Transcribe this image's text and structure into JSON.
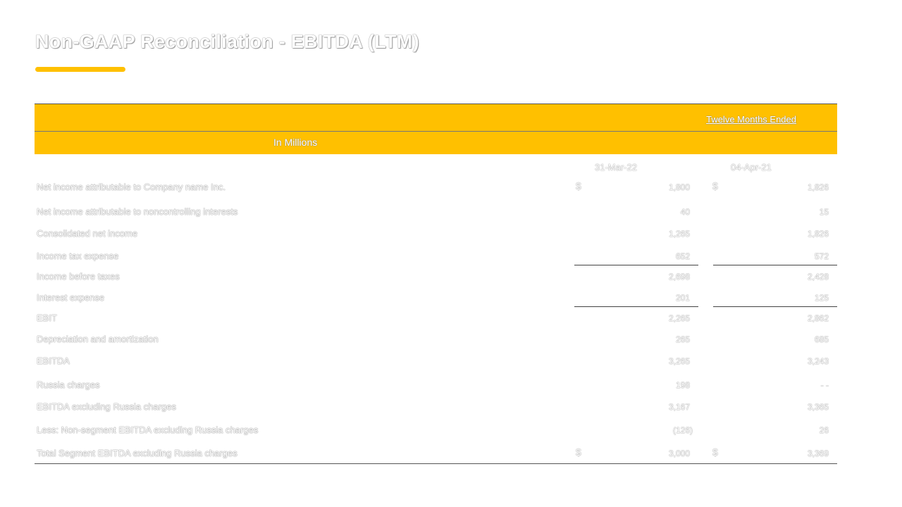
{
  "title": "Non-GAAP Reconciliation - EBITDA (LTM)",
  "table": {
    "period_header": "Twelve Months Ended",
    "units_label": "In Millions",
    "col1_date": "31-Mar-22",
    "col2_date": "04-Apr-21",
    "currency_symbol": "$",
    "rows": [
      {
        "label": "Net income attributable to Company name Inc.",
        "v1": "1,800",
        "v2": "1,826"
      },
      {
        "label": "Net income attributable to noncontrolling interests",
        "v1": "40",
        "v2": "15"
      },
      {
        "label": "Consolidated net income",
        "v1": "1,265",
        "v2": "1,826"
      },
      {
        "label": "Income tax expense",
        "v1": "652",
        "v2": "572"
      },
      {
        "label": "Income before taxes",
        "v1": "2,698",
        "v2": "2,428"
      },
      {
        "label": "Interest expense",
        "v1": "201",
        "v2": "125"
      },
      {
        "label": "EBIT",
        "v1": "2,265",
        "v2": "2,862"
      },
      {
        "label": "Depreciation and amortization",
        "v1": "265",
        "v2": "685"
      },
      {
        "label": "EBITDA",
        "v1": "3,265",
        "v2": "3,243"
      },
      {
        "label": "Russia charges",
        "v1": "198",
        "v2": "- -"
      },
      {
        "label": "EBITDA excluding Russia charges",
        "v1": "3,167",
        "v2": "3,365"
      },
      {
        "label": "Less: Non-segment EBITDA excluding Russia charges",
        "v1": "(126)",
        "v2": "26"
      },
      {
        "label": "Total Segment EBITDA excluding Russia charges",
        "v1": "3,000",
        "v2": "3,369"
      }
    ]
  },
  "colors": {
    "accent": "#FFC000"
  }
}
